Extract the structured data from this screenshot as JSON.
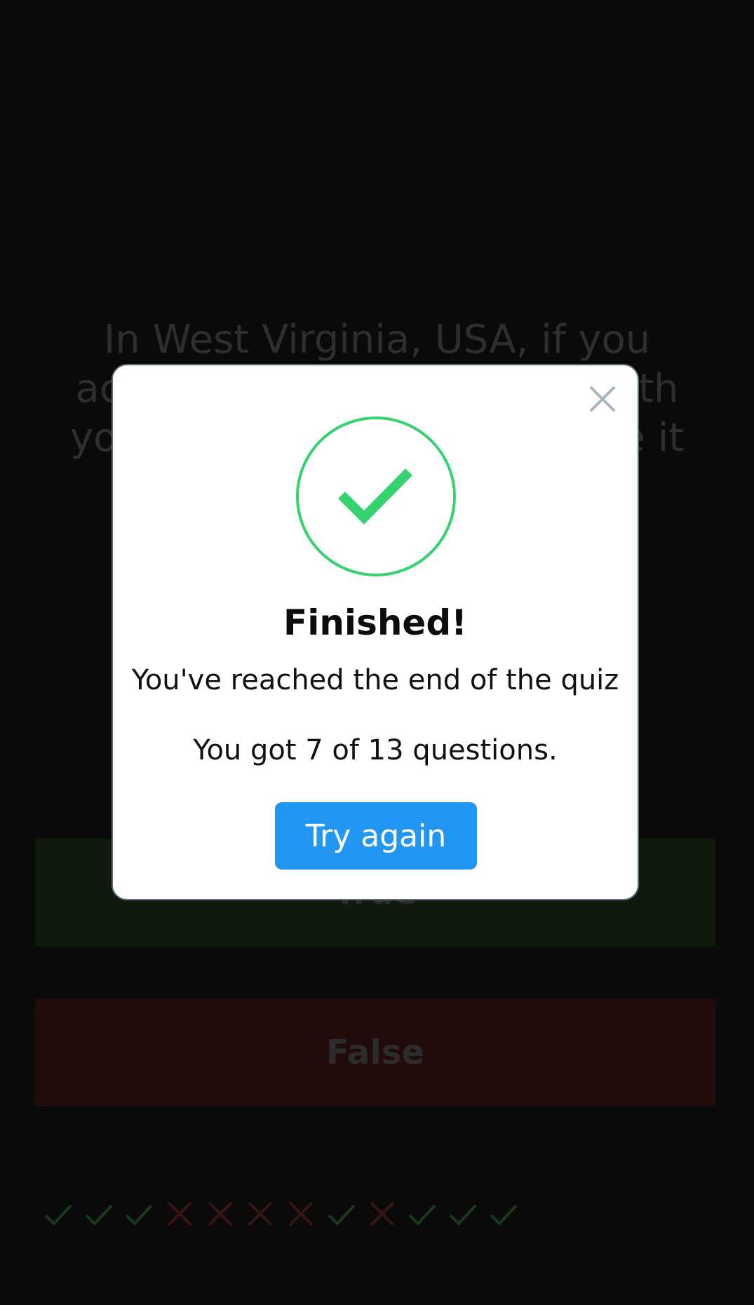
{
  "quiz": {
    "question": "In West Virginia, USA, if you accidentally hit an animal with your car, you are free to take it home to eat.",
    "answers": {
      "true_label": "True",
      "false_label": "False"
    },
    "results": [
      "correct",
      "correct",
      "correct",
      "wrong",
      "wrong",
      "wrong",
      "wrong",
      "correct",
      "wrong",
      "correct",
      "correct",
      "correct"
    ]
  },
  "modal": {
    "title": "Finished!",
    "subtitle": "You've reached the end of the quiz",
    "score_text": "You got 7 of 13 questions.",
    "button_label": "Try again",
    "icons": {
      "close": "close-icon",
      "success": "check-circle-icon"
    }
  },
  "colors": {
    "success_green": "#34d370",
    "button_blue": "#2196f3",
    "close_gray": "#a9b4c2",
    "dim_green": "#173a1c",
    "dim_red": "#3a1414"
  }
}
